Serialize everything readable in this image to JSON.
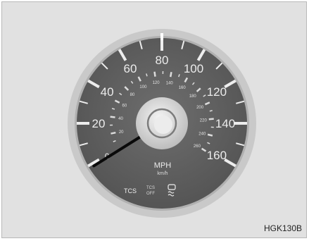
{
  "figure": {
    "reference_code": "HGK130B"
  },
  "speedometer": {
    "unit_primary": "MPH",
    "unit_secondary": "km/h",
    "mph_labels": [
      "0",
      "20",
      "40",
      "60",
      "80",
      "100",
      "120",
      "140",
      "160"
    ],
    "kmh_labels": [
      "20",
      "40",
      "60",
      "80",
      "100",
      "120",
      "140",
      "160",
      "180",
      "200",
      "220",
      "240",
      "260"
    ],
    "needle_reading_mph": 0,
    "indicators": {
      "tcs_label": "TCS",
      "tcs_off_top": "TCS",
      "tcs_off_bottom": "OFF",
      "icon": "traction-control-icon"
    }
  },
  "colors": {
    "dial_face": "#646464",
    "bezel": "#c4c4c4",
    "scale_text": "#ececec",
    "needle": "#0a0a0a",
    "hub": "#dcdcdc"
  }
}
